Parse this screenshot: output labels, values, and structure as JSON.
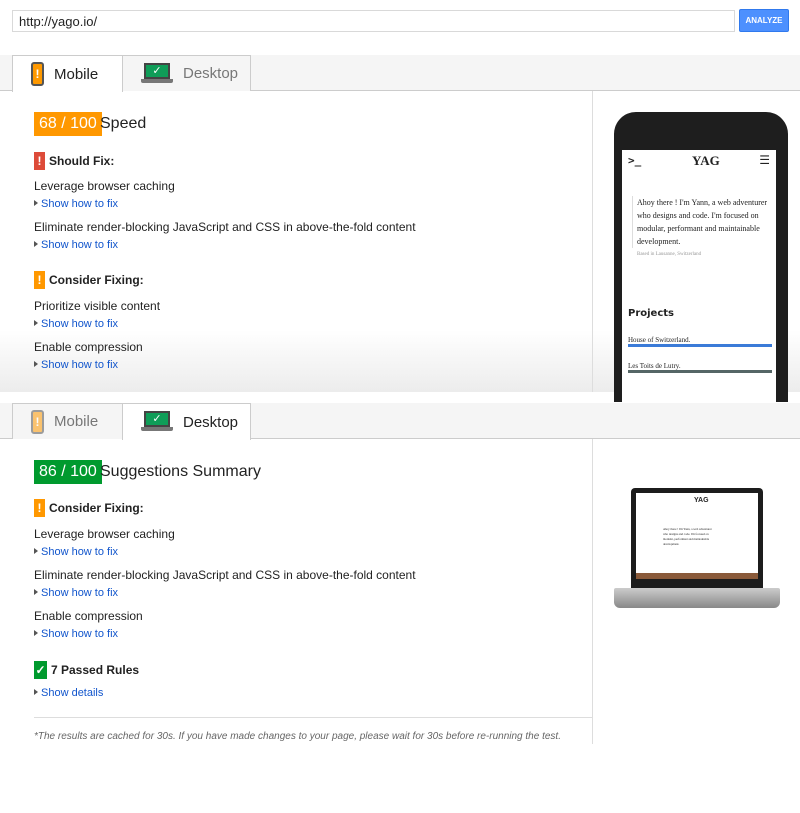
{
  "search": {
    "url": "http://yago.io/",
    "analyze_label": "ANALYZE",
    "accent": "#4d90fe"
  },
  "mobile": {
    "tabs": [
      "Mobile",
      "Desktop"
    ],
    "score": "68 / 100",
    "score_label": "Speed",
    "score_color": "#ff9800",
    "should_fix": {
      "label": "Should Fix:",
      "items": [
        "Leverage browser caching",
        "Eliminate render-blocking JavaScript and CSS in above-the-fold content"
      ]
    },
    "consider_fixing": {
      "label": "Consider Fixing:",
      "items": [
        "Prioritize visible content",
        "Enable compression"
      ]
    },
    "link": "Show how to fix",
    "preview": {
      "intro": "Ahoy there ! I'm Yann, a web adventurer who designs and code. I'm focused on modular, performant and maintainable development.",
      "location": "Based in Lausanne, Switzerland",
      "projects_title": "Projects",
      "projects": [
        "House of Switzerland.",
        "Les Toits de Lutry."
      ],
      "logo": "YAG"
    }
  },
  "desktop": {
    "tabs": [
      "Mobile",
      "Desktop"
    ],
    "score": "86 / 100",
    "score_label": "Suggestions Summary",
    "score_color": "#009a2e",
    "consider_fixing": {
      "label": "Consider Fixing:",
      "items": [
        "Leverage browser caching",
        "Eliminate render-blocking JavaScript and CSS in above-the-fold content",
        "Enable compression"
      ]
    },
    "link": "Show how to fix",
    "passed": {
      "label": "7 Passed Rules",
      "link": "Show details"
    },
    "footer": "*The results are cached for 30s. If you have made changes to your page, please wait for 30s before re-running the test."
  }
}
